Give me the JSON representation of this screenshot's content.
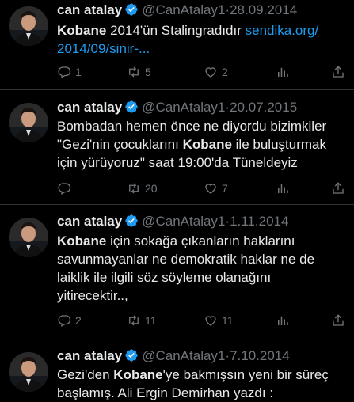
{
  "tweets": [
    {
      "name": "can atalay",
      "handle": "@CanAtalay1",
      "date": "28.09.2014",
      "body_parts": [
        {
          "t": "Kobane",
          "b": true
        },
        {
          "t": " 2014'ün Stalingradıdır ",
          "b": false
        },
        {
          "t": "sendika.org/\n2014/09/sinir-...",
          "link": true
        }
      ],
      "replies": "1",
      "retweets": "5",
      "likes": "2"
    },
    {
      "name": "can atalay",
      "handle": "@CanAtalay1",
      "date": "20.07.2015",
      "body_parts": [
        {
          "t": "Bombadan hemen önce ne diyordu bizimkiler\n\"Gezi'nin çocuklarını ",
          "b": false
        },
        {
          "t": "Kobane",
          "b": true
        },
        {
          "t": " ile buluşturmak\niçin yürüyoruz\" saat 19:00'da Tüneldeyiz",
          "b": false
        }
      ],
      "replies": "",
      "retweets": "20",
      "likes": "7"
    },
    {
      "name": "can atalay",
      "handle": "@CanAtalay1",
      "date": "1.11.2014",
      "body_parts": [
        {
          "t": "Kobane",
          "b": true
        },
        {
          "t": " için sokağa çıkanların haklarını\nsavunmayanlar ne demokratik haklar ne de\nlaiklik ile ilgili söz söyleme olanağını\nyitirecektir..,",
          "b": false
        }
      ],
      "replies": "2",
      "retweets": "11",
      "likes": "11"
    },
    {
      "name": "can atalay",
      "handle": "@CanAtalay1",
      "date": "7.10.2014",
      "body_parts": [
        {
          "t": "Gezi'den ",
          "b": false
        },
        {
          "t": "Kobane",
          "b": true
        },
        {
          "t": "'ye bakmışsın yeni bir süreç\nbaşlamış. Ali Ergin Demirhan yazdı :",
          "b": false
        }
      ],
      "replies": "",
      "retweets": "",
      "likes": ""
    }
  ],
  "colors": {
    "background": "#000000",
    "text": "#e7e9ea",
    "muted": "#71767b",
    "link": "#1d9bf0",
    "verified": "#1d9bf0"
  },
  "icons": [
    "verified-badge-icon",
    "reply-icon",
    "retweet-icon",
    "like-icon",
    "views-icon",
    "share-icon"
  ]
}
